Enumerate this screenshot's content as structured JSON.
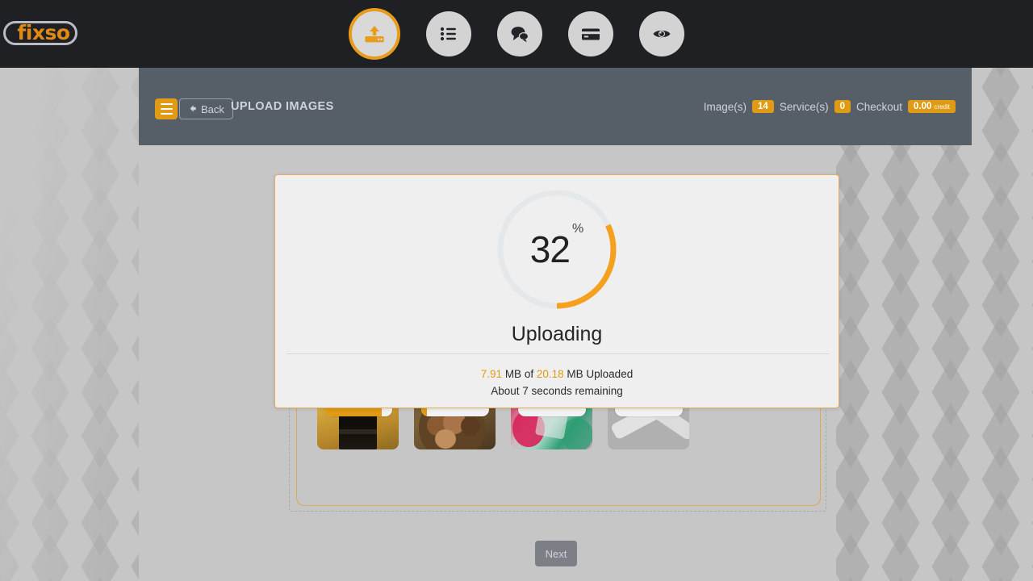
{
  "brand": {
    "name": "fixso"
  },
  "topnav": {
    "items": [
      {
        "name": "upload-icon",
        "label": "Upload",
        "active": true
      },
      {
        "name": "list-icon",
        "label": "Orders",
        "active": false
      },
      {
        "name": "chat-icon",
        "label": "Messages",
        "active": false
      },
      {
        "name": "credit-card-icon",
        "label": "Billing",
        "active": false
      },
      {
        "name": "eye-icon",
        "label": "Preview",
        "active": false
      }
    ]
  },
  "header": {
    "menu_label": "Menu",
    "back_label": "Back",
    "title": "UPLOAD IMAGES",
    "images_label": "Image(s)",
    "images_count": "14",
    "services_label": "Service(s)",
    "services_count": "0",
    "checkout_label": "Checkout",
    "checkout_amount": "0.00",
    "checkout_unit": "credit"
  },
  "modal": {
    "percent": "32",
    "percent_symbol": "%",
    "status": "Uploading",
    "uploaded_size": "7.91",
    "total_size": "20.18",
    "size_unit_1": "MB of",
    "size_unit_2": "MB Uploaded",
    "time_remaining": "About 7 seconds remaining",
    "accent_color": "#f5a01e",
    "track_color": "#e4e8ea"
  },
  "dropzone": {
    "thumbnails": [
      {
        "name": "thumbnail-perfume-gold",
        "progress": 85
      },
      {
        "name": "thumbnail-onion-bowls",
        "progress": 8
      },
      {
        "name": "thumbnail-perfume-floral",
        "progress": 0
      },
      {
        "name": "thumbnail-smartwatch",
        "progress": 0
      }
    ]
  },
  "footer": {
    "next_label": "Next"
  }
}
